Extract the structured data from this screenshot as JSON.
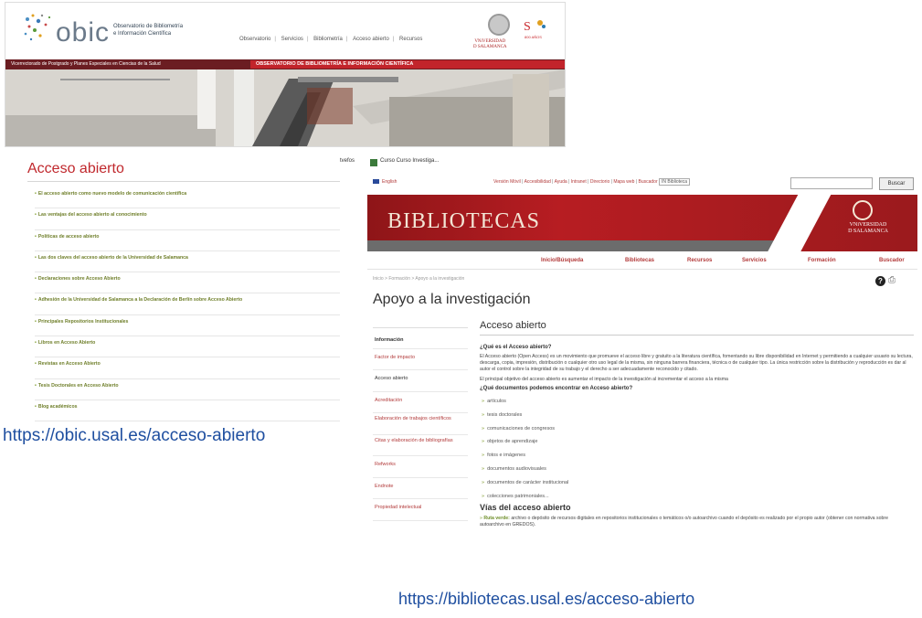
{
  "obic": {
    "logo_text": "obic",
    "logo_subtitle_1": "Observatorio de Bibliometría",
    "logo_subtitle_2": "e Información Científica",
    "nav": [
      "Observatorio",
      "Servicios",
      "Bibliometría",
      "Acceso abierto",
      "Recursos"
    ],
    "usal_label_1": "VNiVERSIDAD",
    "usal_label_2": "D SALAMANCA",
    "anniversary": "800 AÑOS",
    "bar_left": "Vicerrectorado de Postgrado y Planes Especiales en Ciencias de la Salud",
    "bar_right": "OBSERVATORIO DE BIBLIOMETRÍA E INFORMACIÓN CIENTÍFICA"
  },
  "acceso": {
    "title": "Acceso abierto",
    "items": [
      "El acceso abierto como nuevo modelo de comunicación científica",
      "Las ventajas del acceso abierto al conocimiento",
      "Políticas de acceso abierto",
      "Las dos claves del acceso abierto de la Universidad de Salamanca",
      "Declaraciones sobre Acceso Abierto",
      "Adhesión de la Universidad de Salamanca a la Declaración de Berlín sobre Acceso Abierto",
      "Principales Repositorios Institucionales",
      "Libros en Acceso Abierto",
      "Revistas en Acceso Abierto",
      "Tesis Doctorales en Acceso Abierto",
      "Blog académicos"
    ],
    "url": "https://obic.usal.es/acceso-abierto"
  },
  "bib": {
    "toolbar_label": "tvefos",
    "toolbar_fav": "Curso Curso Investiga...",
    "english": "English",
    "top_links": [
      "Versión Móvil",
      "Accesibilidad",
      "Ayuda",
      "Intranet",
      "Directorio",
      "Mapa web",
      "Buscador"
    ],
    "search_select": "IN Biblioteca",
    "search_button": "Buscar",
    "banner_word": "BIBLIOTECAS",
    "banner_univ_1": "VNiVERSIDAD",
    "banner_univ_2": "D SALAMANCA",
    "nav": [
      "Inicio/Búsqueda",
      "Bibliotecas",
      "Recursos",
      "Servicios",
      "Formación",
      "Buscador"
    ],
    "breadcrumb": "Inicio > Formación > Apoyo a la investigación",
    "help_icon": "?",
    "page_title": "Apoyo a la investigación",
    "side": [
      "Información",
      "Factor de impacto",
      "Acceso abierto",
      "Acreditación",
      "Elaboración de trabajos científicos",
      "Citas y elaboración de bibliografías",
      "Refworks",
      "Endnote",
      "Propiedad intelectual"
    ],
    "main_title": "Acceso abierto",
    "q1": "¿Qué es el Acceso abierto?",
    "p1": "El Acceso abierto (Open Access) es un movimiento que promueve el acceso libre y gratuito a la literatura científica, fomentando su libre disponibilidad en Internet y permitiendo a cualquier usuario su lectura, descarga, copia, impresión, distribución o cualquier otro uso legal de la misma, sin ninguna barrera financiera, técnica o de cualquier tipo. La única restricción sobre la distribución y reproducción es dar al autor el control sobre la integridad de su trabajo y el derecho a ser adecuadamente reconocido y citado.",
    "p2": "El principal objetivo del acceso abierto es aumentar el impacto de la investigación al incrementar el acceso a la misma",
    "q2": "¿Qué documentos podemos encontrar en Acceso abierto?",
    "docs": [
      "artículos",
      "tesis doctorales",
      "comunicaciones de congresos",
      "objetos de aprendizaje",
      "fotos e imágenes",
      "documentos audiovisuales",
      "documentos de carácter institucional",
      "colecciones patrimoniales..."
    ],
    "vias": "Vías del acceso abierto",
    "ruta_label": "Ruta verde:",
    "ruta_text": "archivo o depósito de recursos digitales en repositorios institucionales o temáticos o/o autoarchivo cuando el depósito es realizado por el propio autor (obtener con normativa sobre autoarchivo en GREDOS).",
    "url": "https://bibliotecas.usal.es/acceso-abierto"
  }
}
